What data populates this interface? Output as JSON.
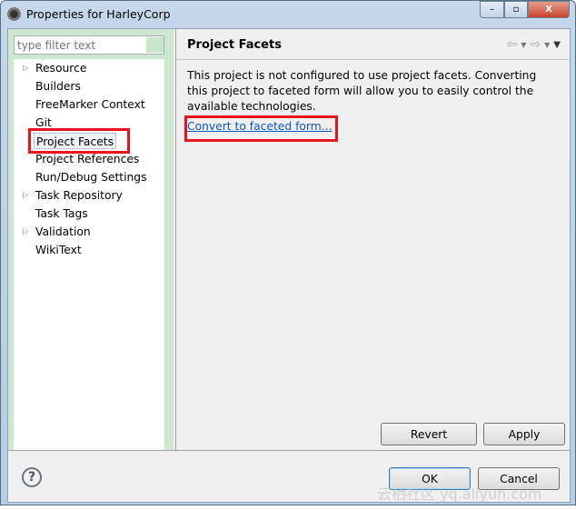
{
  "window": {
    "title": "Properties for HarleyCorp",
    "minimize": "–",
    "maximize": "▫",
    "close": "X"
  },
  "sidebar": {
    "filter_placeholder": "type filter text",
    "items": [
      {
        "label": "Resource",
        "expandable": true
      },
      {
        "label": "Builders",
        "expandable": false
      },
      {
        "label": "FreeMarker Context",
        "expandable": false
      },
      {
        "label": "Git",
        "expandable": false
      },
      {
        "label": "Project Facets",
        "expandable": false,
        "selected": true
      },
      {
        "label": "Project References",
        "expandable": false
      },
      {
        "label": "Run/Debug Settings",
        "expandable": false
      },
      {
        "label": "Task Repository",
        "expandable": true
      },
      {
        "label": "Task Tags",
        "expandable": false
      },
      {
        "label": "Validation",
        "expandable": true
      },
      {
        "label": "WikiText",
        "expandable": false
      }
    ]
  },
  "page": {
    "title": "Project Facets",
    "description": "This project is not configured to use project facets. Converting this project to faceted form will allow you to easily control the available technologies.",
    "convert_link": "Convert to faceted form...",
    "revert": "Revert",
    "apply": "Apply"
  },
  "footer": {
    "help": "?",
    "ok": "OK",
    "cancel": "Cancel"
  },
  "highlight_color": "#e8141c",
  "watermark": "云栖社区 yq.aliyun.com"
}
